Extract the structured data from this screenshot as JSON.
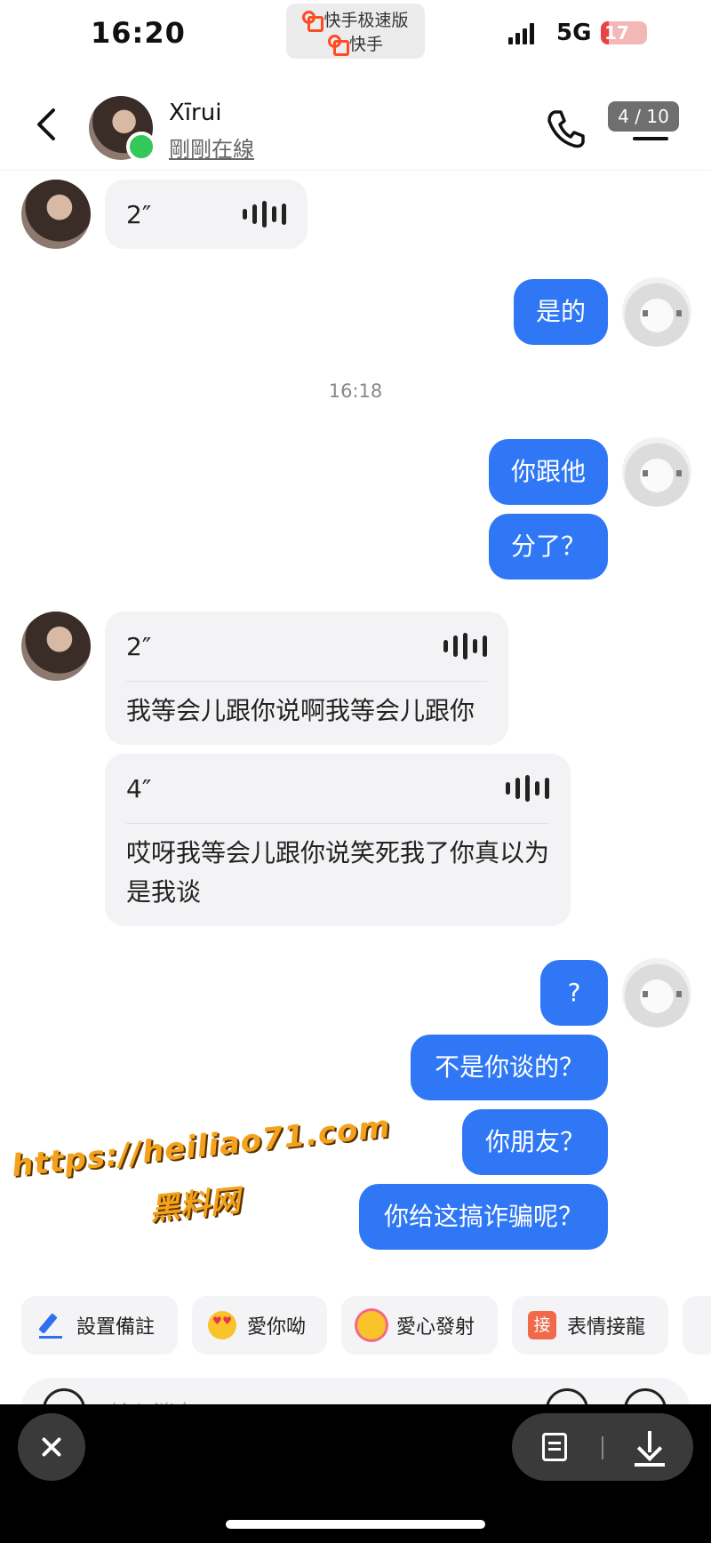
{
  "status_bar": {
    "time": "16:20",
    "app_switcher": [
      "快手极速版",
      "快手"
    ],
    "network": "5G",
    "battery": "17",
    "battery_level": 0.17
  },
  "header": {
    "contact_name": "Xīrui",
    "contact_status": "剛剛在線",
    "page_counter": "4 / 10"
  },
  "messages": {
    "m1": {
      "duration": "2″"
    },
    "m2": {
      "text": "是的"
    },
    "timestamp": "16:18",
    "m3": {
      "text": "你跟他"
    },
    "m4": {
      "text": "分了？"
    },
    "m5": {
      "duration": "2″",
      "transcript": "我等会儿跟你说啊我等会儿跟你"
    },
    "m6": {
      "duration": "4″",
      "transcript": "哎呀我等会儿跟你说笑死我了你真以为是我谈"
    },
    "m7": {
      "text": "?"
    },
    "m8": {
      "text": "不是你谈的？"
    },
    "m9": {
      "text": "你朋友？"
    },
    "m10": {
      "text": "你给这搞诈骗呢？"
    }
  },
  "watermark": {
    "url": "https://heiliao71.com",
    "label": "黑料网"
  },
  "quick_actions": [
    {
      "label": "設置備註",
      "icon": "pencil-icon"
    },
    {
      "label": "愛你呦",
      "icon": "heart-eyes-icon"
    },
    {
      "label": "愛心發射",
      "icon": "hearts-burst-icon"
    },
    {
      "label": "表情接龍",
      "icon": "jie-icon",
      "icon_char": "接"
    }
  ],
  "input": {
    "placeholder": "输入消息"
  },
  "colors": {
    "accent": "#2f77f5",
    "online": "#34c759",
    "watermark": "#f4a21b"
  }
}
